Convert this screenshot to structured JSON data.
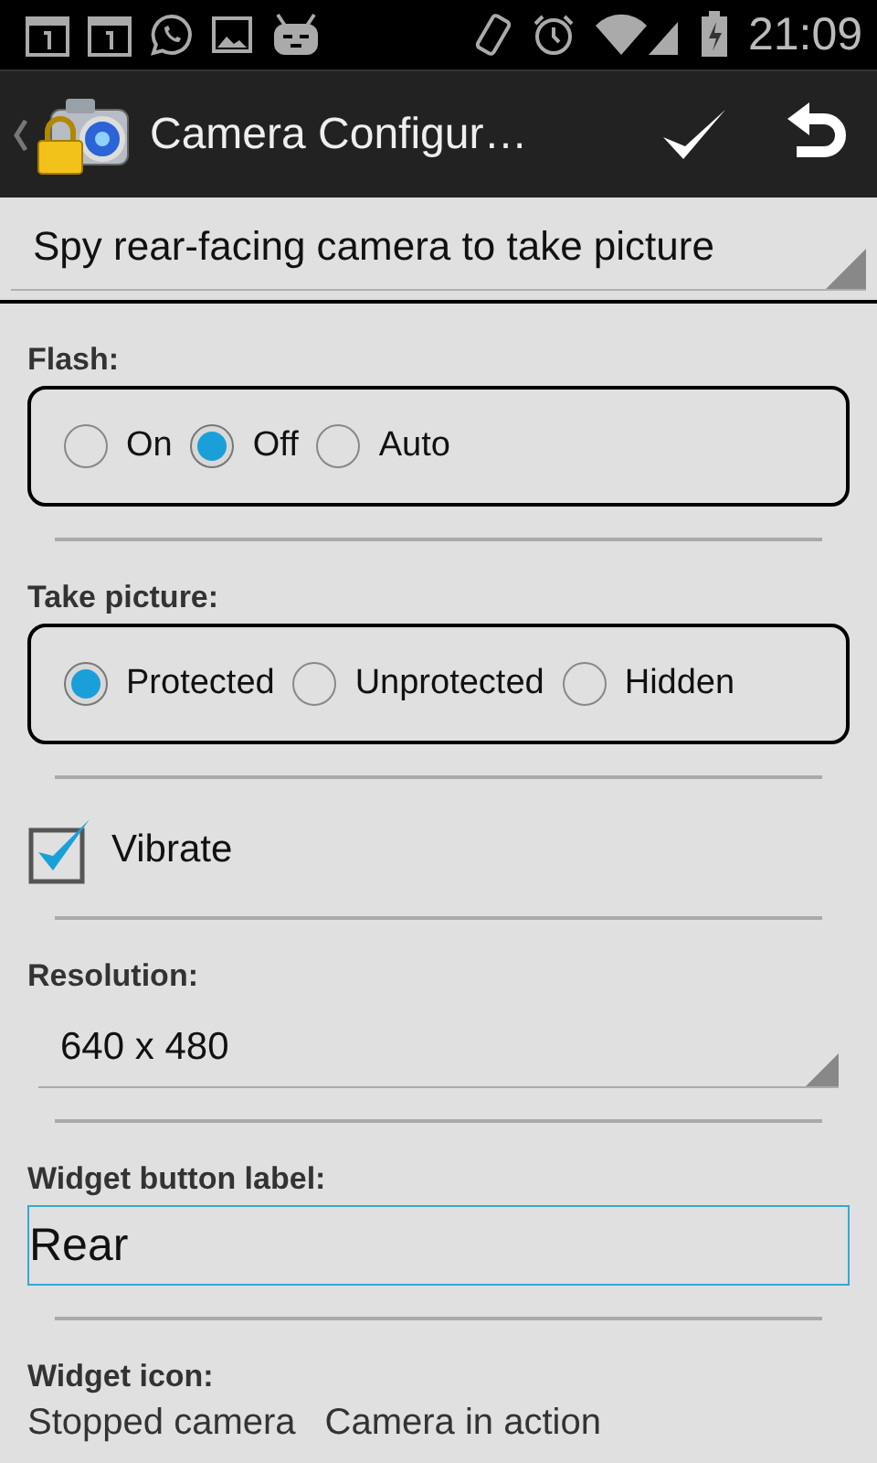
{
  "status_bar": {
    "time": "21:09"
  },
  "action_bar": {
    "title": "Camera Configur…"
  },
  "mode_spinner": {
    "value": "Spy rear-facing camera to take picture"
  },
  "settings": [
    {
      "kind": "radio_group",
      "label": "Flash:",
      "options": [
        {
          "label": "On",
          "selected": false
        },
        {
          "label": "Off",
          "selected": true
        },
        {
          "label": "Auto",
          "selected": false
        }
      ]
    },
    {
      "kind": "radio_group",
      "label": "Take picture:",
      "options": [
        {
          "label": "Protected",
          "selected": true
        },
        {
          "label": "Unprotected",
          "selected": false
        },
        {
          "label": "Hidden",
          "selected": false
        }
      ]
    },
    {
      "kind": "checkbox",
      "label": "Vibrate",
      "checked": true
    },
    {
      "kind": "spinner",
      "label": "Resolution:",
      "value": "640 x 480"
    },
    {
      "kind": "text_input",
      "label": "Widget button label:",
      "value": "Rear",
      "focused": true
    },
    {
      "kind": "icon_choices",
      "label": "Widget icon:",
      "choices": [
        "Stopped camera",
        "Camera in action"
      ]
    }
  ]
}
